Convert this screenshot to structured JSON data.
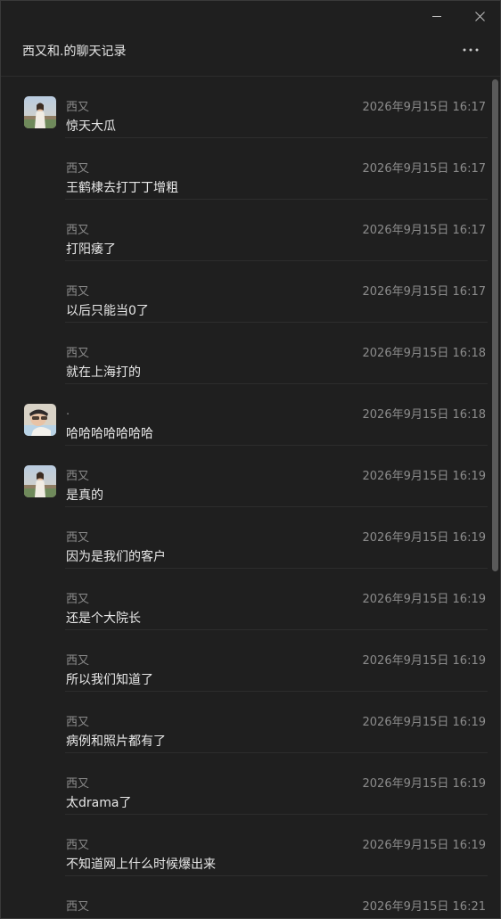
{
  "window": {
    "title": "西又和.的聊天记录"
  },
  "icons": {
    "minimize": "minimize-icon",
    "close": "close-icon",
    "more": "more-horizontal-icon"
  },
  "messages": [
    {
      "sender": "西又",
      "time": "2026年9月15日 16:17",
      "text": "惊天大瓜",
      "avatar": "avatar-xiyou"
    },
    {
      "sender": "西又",
      "time": "2026年9月15日 16:17",
      "text": "王鹤棣去打丁丁增粗",
      "avatar": ""
    },
    {
      "sender": "西又",
      "time": "2026年9月15日 16:17",
      "text": "打阳痿了",
      "avatar": ""
    },
    {
      "sender": "西又",
      "time": "2026年9月15日 16:17",
      "text": "以后只能当0了",
      "avatar": ""
    },
    {
      "sender": "西又",
      "time": "2026年9月15日 16:18",
      "text": "就在上海打的",
      "avatar": ""
    },
    {
      "sender": ".",
      "time": "2026年9月15日 16:18",
      "text": "哈哈哈哈哈哈哈",
      "avatar": "avatar-dot"
    },
    {
      "sender": "西又",
      "time": "2026年9月15日 16:19",
      "text": "是真的",
      "avatar": "avatar-xiyou"
    },
    {
      "sender": "西又",
      "time": "2026年9月15日 16:19",
      "text": "因为是我们的客户",
      "avatar": ""
    },
    {
      "sender": "西又",
      "time": "2026年9月15日 16:19",
      "text": "还是个大院长",
      "avatar": ""
    },
    {
      "sender": "西又",
      "time": "2026年9月15日 16:19",
      "text": "所以我们知道了",
      "avatar": ""
    },
    {
      "sender": "西又",
      "time": "2026年9月15日 16:19",
      "text": "病例和照片都有了",
      "avatar": ""
    },
    {
      "sender": "西又",
      "time": "2026年9月15日 16:19",
      "text": "太drama了",
      "avatar": ""
    },
    {
      "sender": "西又",
      "time": "2026年9月15日 16:19",
      "text": "不知道网上什么时候爆出来",
      "avatar": ""
    },
    {
      "sender": "西又",
      "time": "2026年9月15日 16:21",
      "text": "",
      "avatar": ""
    }
  ]
}
